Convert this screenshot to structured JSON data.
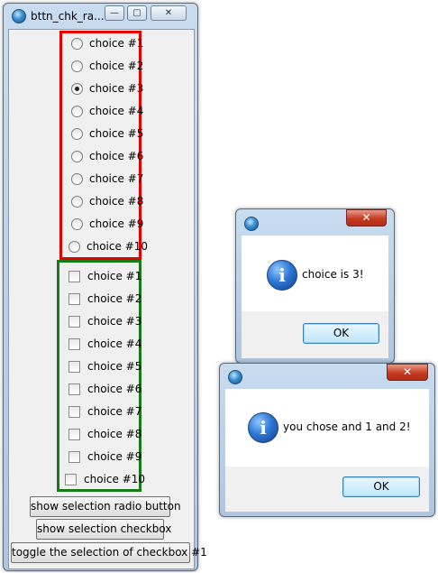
{
  "main_window": {
    "title": "bttn_chk_ra...",
    "caption_buttons": {
      "minimize": "—",
      "maximize": "▢",
      "close": "✕"
    },
    "radio_options": [
      {
        "label": "choice #1",
        "checked": false
      },
      {
        "label": "choice #2",
        "checked": false
      },
      {
        "label": "choice #3",
        "checked": true
      },
      {
        "label": "choice #4",
        "checked": false
      },
      {
        "label": "choice #5",
        "checked": false
      },
      {
        "label": "choice #6",
        "checked": false
      },
      {
        "label": "choice #7",
        "checked": false
      },
      {
        "label": "choice #8",
        "checked": false
      },
      {
        "label": "choice #9",
        "checked": false
      },
      {
        "label": "choice #10",
        "checked": false
      }
    ],
    "checkbox_options": [
      {
        "label": "choice #1",
        "checked": false
      },
      {
        "label": "choice #2",
        "checked": false
      },
      {
        "label": "choice #3",
        "checked": false
      },
      {
        "label": "choice #4",
        "checked": false
      },
      {
        "label": "choice #5",
        "checked": false
      },
      {
        "label": "choice #6",
        "checked": false
      },
      {
        "label": "choice #7",
        "checked": false
      },
      {
        "label": "choice #8",
        "checked": false
      },
      {
        "label": "choice #9",
        "checked": false
      },
      {
        "label": "choice #10",
        "checked": false
      }
    ],
    "buttons": {
      "show_radio": "show selection radio button",
      "show_checkbox": "show selection checkbox",
      "toggle": "toggle the selection of checkbox #1"
    },
    "colors": {
      "radio_frame": "#e60000",
      "checkbox_frame": "#1a7a1a"
    }
  },
  "dialog_radio": {
    "close": "✕",
    "message": "choice is 3!",
    "ok_label": "OK",
    "icon": "info-icon"
  },
  "dialog_checkbox": {
    "close": "✕",
    "message": "you chose  and 1 and 2!",
    "ok_label": "OK",
    "icon": "info-icon"
  }
}
